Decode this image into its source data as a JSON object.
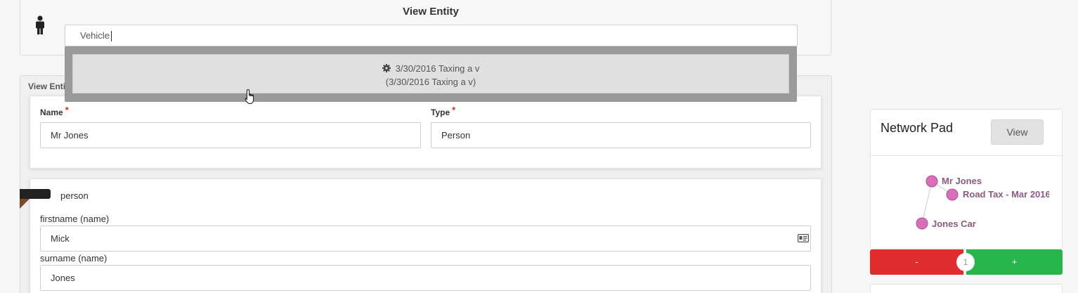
{
  "header": {
    "title": "View Entity",
    "search_value": "Vehicle",
    "icon": "person-icon"
  },
  "dropdown": {
    "items": [
      {
        "line1": "3/30/2016 Taxing a v",
        "line2": "(3/30/2016 Taxing a v)",
        "icon": "gear-icon"
      }
    ]
  },
  "section": {
    "header": "View Entity",
    "name_label": "Name",
    "name_value": "Mr Jones",
    "type_label": "Type",
    "type_value": "Person",
    "required_mark": "*"
  },
  "person_card": {
    "title": "person",
    "firstname_label": "firstname (name)",
    "firstname_value": "Mick",
    "surname_label": "surname (name)",
    "surname_value": "Jones"
  },
  "network_pad": {
    "title": "Network Pad",
    "view_label": "View",
    "nodes": [
      "Mr Jones",
      "Road Tax - Mar 2016",
      "Jones Car"
    ],
    "zoom_out_label": "-",
    "zoom_in_label": "+",
    "zoom_level": "1"
  },
  "colors": {
    "node_fill": "#d96fb8",
    "node_label": "#8a5a80",
    "minus": "#e02c2c",
    "plus": "#26b64c"
  }
}
